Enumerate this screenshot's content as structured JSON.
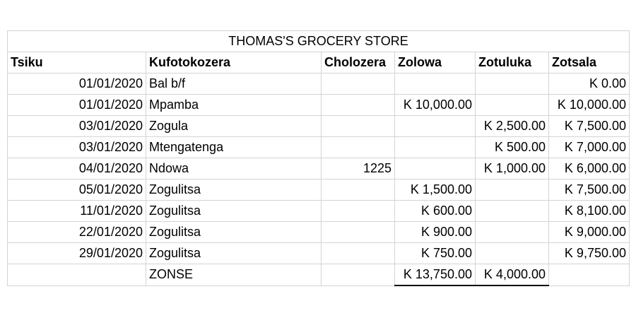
{
  "title": "THOMAS'S GROCERY STORE",
  "headers": {
    "date": "Tsiku",
    "description": "Kufotokozera",
    "reference": "Cholozera",
    "debit": "Zolowa",
    "credit": "Zotuluka",
    "balance": "Zotsala"
  },
  "rows": [
    {
      "date": "01/01/2020",
      "description": "Bal b/f",
      "reference": "",
      "debit": "",
      "credit": "",
      "balance": "K 0.00"
    },
    {
      "date": "01/01/2020",
      "description": "Mpamba",
      "reference": "",
      "debit": "K 10,000.00",
      "credit": "",
      "balance": "K 10,000.00"
    },
    {
      "date": "03/01/2020",
      "description": "Zogula",
      "reference": "",
      "debit": "",
      "credit": "K 2,500.00",
      "balance": "K 7,500.00"
    },
    {
      "date": "03/01/2020",
      "description": "Mtengatenga",
      "reference": "",
      "debit": "",
      "credit": "K 500.00",
      "balance": "K 7,000.00"
    },
    {
      "date": "04/01/2020",
      "description": "Ndowa",
      "reference": "1225",
      "debit": "",
      "credit": "K 1,000.00",
      "balance": "K 6,000.00"
    },
    {
      "date": "05/01/2020",
      "description": "Zogulitsa",
      "reference": "",
      "debit": "K 1,500.00",
      "credit": "",
      "balance": "K 7,500.00"
    },
    {
      "date": "11/01/2020",
      "description": "Zogulitsa",
      "reference": "",
      "debit": "K 600.00",
      "credit": "",
      "balance": "K 8,100.00"
    },
    {
      "date": "22/01/2020",
      "description": "Zogulitsa",
      "reference": "",
      "debit": "K 900.00",
      "credit": "",
      "balance": "K 9,000.00"
    },
    {
      "date": "29/01/2020",
      "description": "Zogulitsa",
      "reference": "",
      "debit": "K 750.00",
      "credit": "",
      "balance": "K 9,750.00"
    }
  ],
  "totals": {
    "label": "ZONSE",
    "debit": "K 13,750.00",
    "credit": "K 4,000.00"
  }
}
